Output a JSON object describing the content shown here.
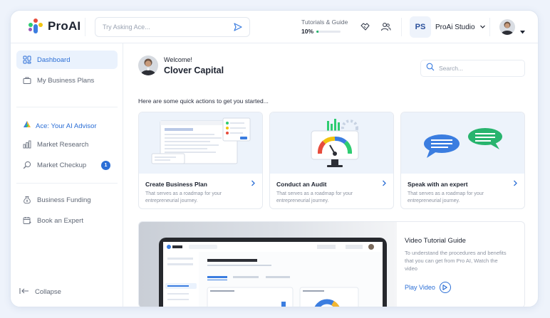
{
  "brand": {
    "name": "ProAI"
  },
  "header": {
    "ask_placeholder": "Try Asking Ace...",
    "tutorials_label": "Tutorials & Guide",
    "tutorials_progress_label": "10%",
    "tutorials_progress": 0.1,
    "studio_initials": "PS",
    "studio_name": "ProAi Studio"
  },
  "sidebar": {
    "items": [
      {
        "label": "Dashboard",
        "icon": "grid-icon"
      },
      {
        "label": "My Business Plans",
        "icon": "briefcase-icon"
      },
      {
        "label": "Market Research",
        "icon": "bar-chart-icon"
      },
      {
        "label": "Market Checkup",
        "icon": "magnifier-icon",
        "badge": "1"
      },
      {
        "label": "Business Funding",
        "icon": "money-bag-icon"
      },
      {
        "label": "Book an Expert",
        "icon": "calendar-icon"
      }
    ],
    "advisor_label": "Ace: Your AI Advisor",
    "collapse_label": "Collapse"
  },
  "main": {
    "welcome_small": "Welcome!",
    "welcome_name": "Clover Capital",
    "search_placeholder": "Search...",
    "quick_actions_text": "Here are some quick actions to get you started...",
    "cards": [
      {
        "title": "Create Business Plan",
        "desc": "That serves as a roadmap for your entrepreneurial journey."
      },
      {
        "title": "Conduct an Audit",
        "desc": "That serves as a roadmap for your entrepreneurial journey."
      },
      {
        "title": "Speak with an expert",
        "desc": "That serves as a roadmap for your entrepreneurial journey."
      }
    ],
    "video": {
      "title": "Video Tutorial Guide",
      "desc": "To understand the procedures and benefits that you can get from Pro AI, Watch the video",
      "play_label": "Play Video"
    }
  },
  "colors": {
    "accent": "#2c6fd6",
    "progress": "#28b46e",
    "active_bg": "#eaf2fd"
  }
}
